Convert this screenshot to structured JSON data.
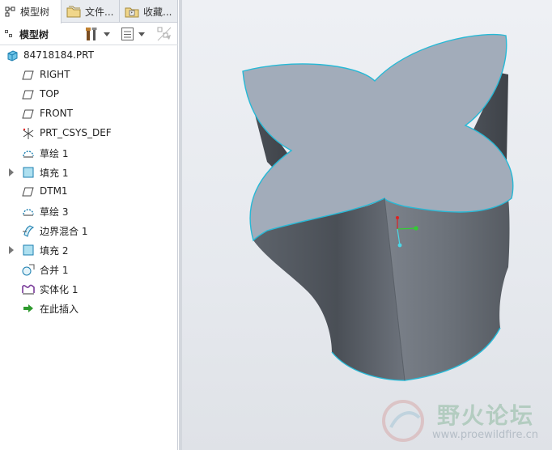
{
  "tabs": [
    {
      "label": "模型树",
      "icon": "model-tree-icon"
    },
    {
      "label": "文件...",
      "icon": "folder-icon"
    },
    {
      "label": "收藏...",
      "icon": "favorites-icon"
    }
  ],
  "toolbar": {
    "title": "模型树"
  },
  "tree": {
    "root": "84718184.PRT",
    "items": [
      {
        "label": "RIGHT",
        "icon": "datum-plane-icon"
      },
      {
        "label": "TOP",
        "icon": "datum-plane-icon"
      },
      {
        "label": "FRONT",
        "icon": "datum-plane-icon"
      },
      {
        "label": "PRT_CSYS_DEF",
        "icon": "coordinate-system-icon"
      },
      {
        "label": "草绘 1",
        "icon": "sketch-icon"
      },
      {
        "label": "填充 1",
        "icon": "fill-icon"
      },
      {
        "label": "DTM1",
        "icon": "datum-plane-icon"
      },
      {
        "label": "草绘 3",
        "icon": "sketch-icon"
      },
      {
        "label": "边界混合 1",
        "icon": "boundary-blend-icon"
      },
      {
        "label": "填充 2",
        "icon": "fill-icon"
      },
      {
        "label": "合并 1",
        "icon": "merge-icon"
      },
      {
        "label": "实体化 1",
        "icon": "solidify-icon"
      },
      {
        "label": "在此插入",
        "icon": "insert-here-arrow-icon"
      }
    ]
  },
  "watermark": {
    "name": "野火论坛",
    "url": "www.proewildfire.cn"
  },
  "colors": {
    "model_top": "#a2acba",
    "model_side_dark": "#4c5158",
    "model_side_light": "#7a8089",
    "edge": "#27b9d6",
    "viewport_bg": "#e8eaee"
  }
}
